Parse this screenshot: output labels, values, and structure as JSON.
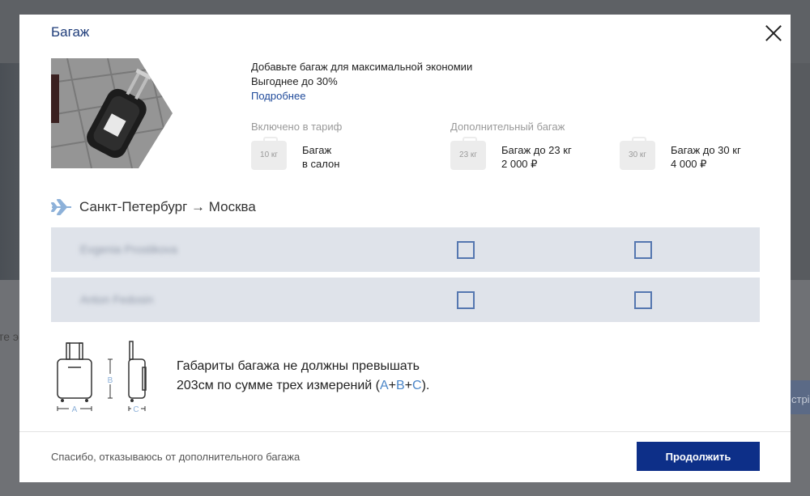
{
  "background": {
    "fragment_left": "те э",
    "fragment_right": "стрі"
  },
  "modal": {
    "title": "Багаж",
    "promo": {
      "line1": "Добавьте багаж для максимальной экономии",
      "line2": "Выгоднее до 30%",
      "link": "Подробнее"
    },
    "included": {
      "label": "Включено в тариф",
      "icon_text": "10 кг",
      "line1": "Багаж",
      "line2": "в салон"
    },
    "additional": {
      "label": "Дополнительный багаж",
      "options": [
        {
          "icon_text": "23 кг",
          "line1": "Багаж до 23 кг",
          "line2": "2 000 ₽"
        },
        {
          "icon_text": "30 кг",
          "line1": "Багаж до 30 кг",
          "line2": "4 000 ₽"
        }
      ]
    },
    "route": "Санкт-Петербург → Москва",
    "passengers": [
      {
        "name": "Evgenia Prostikova",
        "option_23": false,
        "option_30": false
      },
      {
        "name": "Anton Fedosin",
        "option_23": false,
        "option_30": false
      }
    ],
    "dims": {
      "label_a": "A",
      "label_b": "B",
      "label_c": "C",
      "line1": "Габариты багажа не должны превышать",
      "line2_prefix": "203см по сумме трех измерений (",
      "a": "A",
      "plus1": "+",
      "b": "B",
      "plus2": "+",
      "c": "C",
      "line2_suffix": ")."
    },
    "footer": {
      "decline": "Спасибо, отказываюсь от дополнительного багажа",
      "continue": "Продолжить"
    }
  },
  "colors": {
    "brand": "#0d2f88",
    "link": "#1f4a9a",
    "accent": "#4b86c8",
    "row_bg": "#dfe3ea"
  }
}
